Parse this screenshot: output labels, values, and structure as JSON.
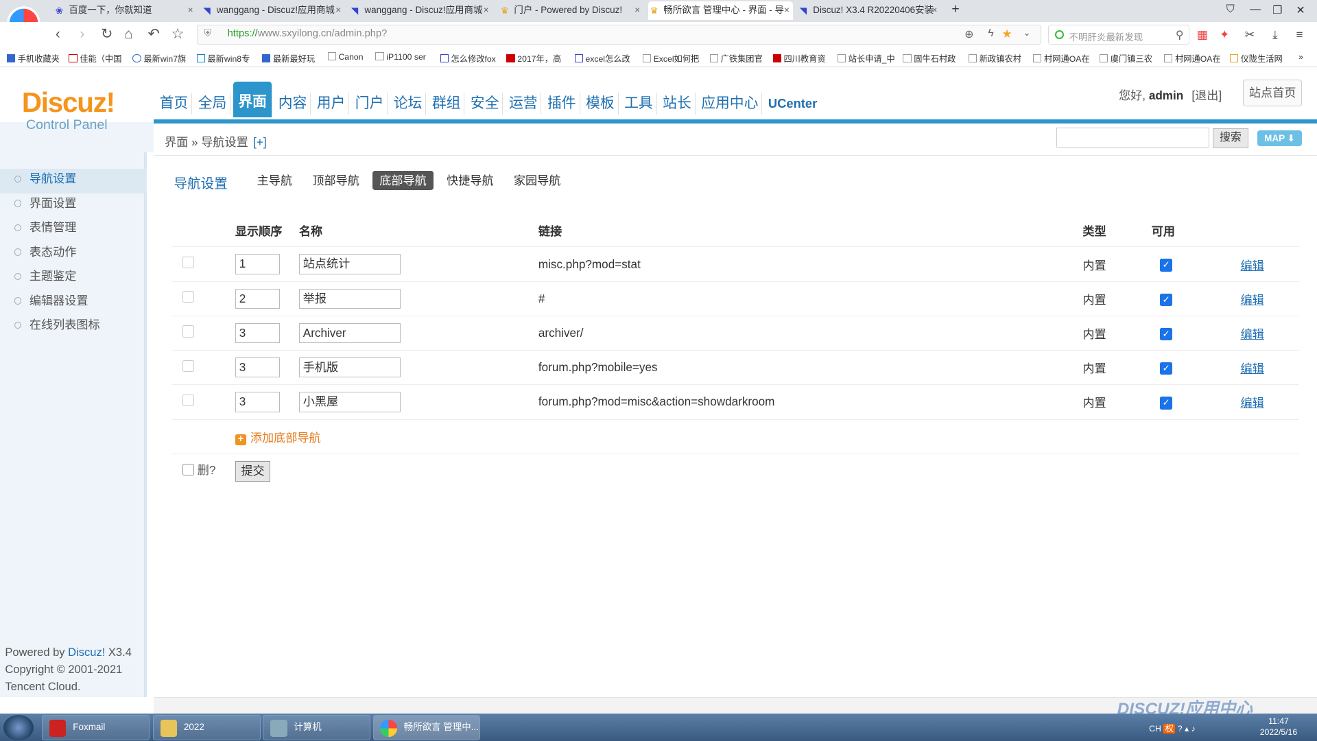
{
  "browser": {
    "tabs": [
      {
        "title": "百度一下，你就知道"
      },
      {
        "title": "wanggang - Discuz!应用商城"
      },
      {
        "title": "wanggang - Discuz!应用商城"
      },
      {
        "title": "门户 - Powered by Discuz!"
      },
      {
        "title": "畅所欲言 管理中心 - 界面 - 导"
      },
      {
        "title": "Discuz! X3.4 R20220406安装"
      }
    ],
    "new_tab": "+",
    "url_scheme": "https://",
    "url_rest": "www.sxyilong.cn/admin.php?",
    "search_placeholder": "不明肝炎最新发现",
    "bookmarks": [
      "手机收藏夹",
      "佳能（中国",
      "最新win7旗",
      "最新win8专",
      "最新最好玩",
      "Canon",
      "iP1100 ser",
      "怎么修改fox",
      "2017年，高",
      "excel怎么改",
      "Excel如何把",
      "广铁集团官",
      "四川教育资",
      "站长申请_中",
      "固牛石村政",
      "新政镇农村",
      "村网通OA在",
      "虞门镇三农",
      "村网通OA在",
      "仪陇生活网"
    ]
  },
  "header": {
    "logo": "Discuz!",
    "logo_sub": "Control Panel",
    "nav": [
      "首页",
      "全局",
      "界面",
      "内容",
      "用户",
      "门户",
      "论坛",
      "群组",
      "安全",
      "运营",
      "插件",
      "模板",
      "工具",
      "站长",
      "应用中心",
      "UCenter"
    ],
    "active_nav": "界面",
    "greeting": "您好,",
    "username": "admin",
    "logout": "[退出]",
    "home_button": "站点首页"
  },
  "breadcrumb": {
    "section": "界面",
    "sep": "»",
    "page": "导航设置",
    "plus": "[+]",
    "search_button": "搜索",
    "map_button": "MAP"
  },
  "sidebar": {
    "items": [
      "导航设置",
      "界面设置",
      "表情管理",
      "表态动作",
      "主题鉴定",
      "编辑器设置",
      "在线列表图标"
    ],
    "active": "导航设置",
    "footer": {
      "line1_prefix": "Powered by ",
      "line1_brand": "Discuz!",
      "line1_version": " X3.4",
      "line2": "Copyright © 2001-2021",
      "line3": "Tencent Cloud."
    }
  },
  "main": {
    "title": "导航设置",
    "subtabs": [
      "主导航",
      "顶部导航",
      "底部导航",
      "快捷导航",
      "家园导航"
    ],
    "active_subtab": "底部导航",
    "columns": {
      "order": "显示顺序",
      "name": "名称",
      "link": "链接",
      "type": "类型",
      "enabled": "可用"
    },
    "rows": [
      {
        "order": "1",
        "name": "站点统计",
        "link": "misc.php?mod=stat",
        "type": "内置",
        "enabled": true,
        "action": "编辑"
      },
      {
        "order": "2",
        "name": "举报",
        "link": "#",
        "type": "内置",
        "enabled": true,
        "action": "编辑"
      },
      {
        "order": "3",
        "name": "Archiver",
        "link": "archiver/",
        "type": "内置",
        "enabled": true,
        "action": "编辑"
      },
      {
        "order": "3",
        "name": "手机版",
        "link": "forum.php?mobile=yes",
        "type": "内置",
        "enabled": true,
        "action": "编辑"
      },
      {
        "order": "3",
        "name": "小黑屋",
        "link": "forum.php?mod=misc&action=showdarkroom",
        "type": "内置",
        "enabled": true,
        "action": "编辑"
      }
    ],
    "add_link": "添加底部导航",
    "delete_label": "删?",
    "submit": "提交"
  },
  "taskbar": {
    "items": [
      "Foxmail",
      "2022",
      "计算机",
      "畅所欲言 管理中..."
    ],
    "tray_lang": "CH",
    "time": "11:47",
    "date": "2022/5/16"
  },
  "watermark": "DISCUZ!应用中心",
  "colors": {
    "accent": "#2b95cc",
    "link": "#1e6fb2",
    "logo": "#f5941c",
    "add": "#e87b1e"
  }
}
